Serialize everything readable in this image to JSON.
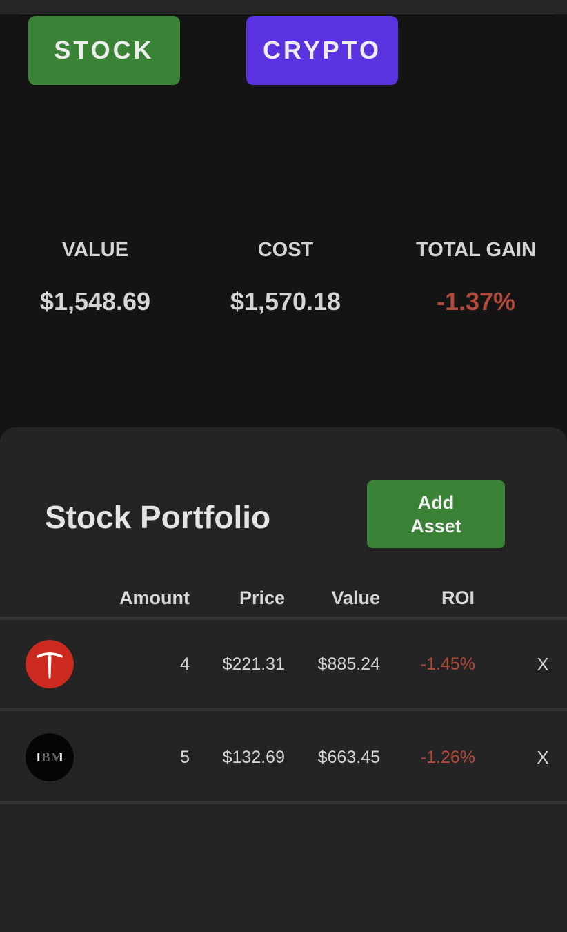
{
  "toggle": {
    "stock_label": "STOCK",
    "crypto_label": "CRYPTO"
  },
  "summary": {
    "value_label": "VALUE",
    "value": "$1,548.69",
    "cost_label": "COST",
    "cost": "$1,570.18",
    "gain_label": "TOTAL GAIN",
    "gain": "-1.37%"
  },
  "portfolio": {
    "title": "Stock Portfolio",
    "add_button_line1": "Add",
    "add_button_line2": "Asset",
    "columns": [
      "Amount",
      "Price",
      "Value",
      "ROI"
    ],
    "rows": [
      {
        "icon": "tesla-logo-icon",
        "amount": "4",
        "price": "$221.31",
        "value": "$885.24",
        "roi": "-1.45%",
        "remove": "X"
      },
      {
        "icon": "ibm-logo-icon",
        "logo_text": "IBM",
        "amount": "5",
        "price": "$132.69",
        "value": "$663.45",
        "roi": "-1.26%",
        "remove": "X"
      }
    ]
  },
  "colors": {
    "background": "#141414",
    "panel": "#242424",
    "stock_button": "#3a8235",
    "crypto_button": "#5b32e0",
    "negative": "#b24a3c",
    "tesla_red": "#cc2a1f"
  }
}
